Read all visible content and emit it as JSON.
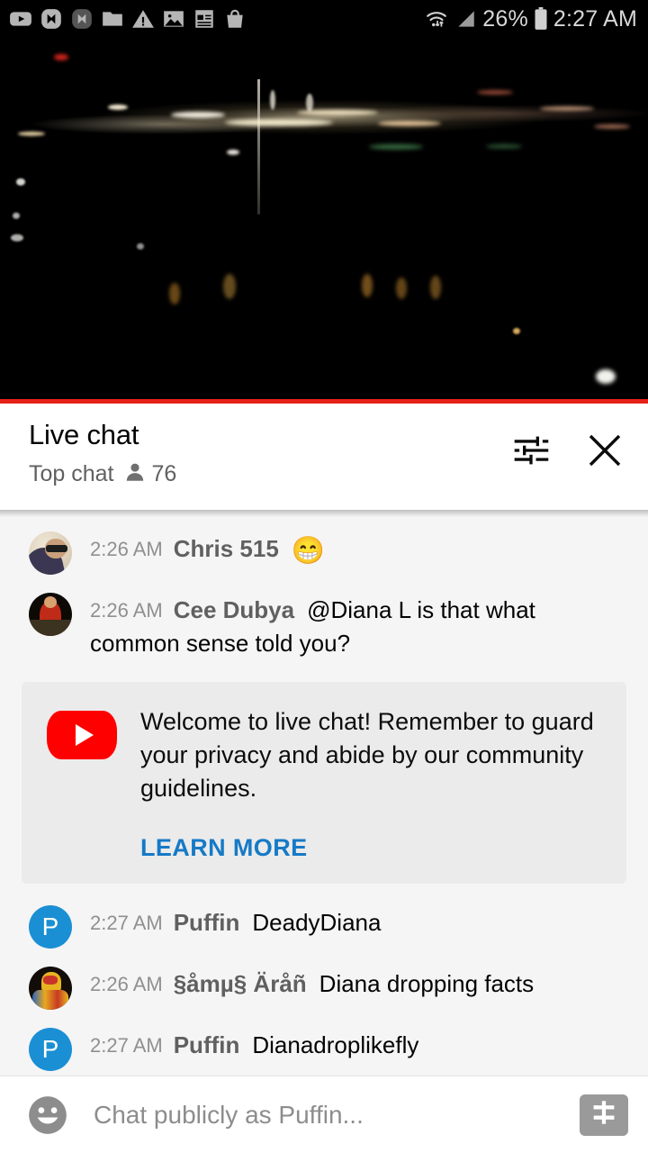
{
  "statusbar": {
    "icons": [
      "youtube-icon",
      "messenger-icon",
      "messenger-alt-icon",
      "folder-icon",
      "warning-icon",
      "image-icon",
      "news-icon",
      "bag-icon"
    ],
    "wifi_icon": "wifi-icon",
    "signal_icon": "cellular-signal-icon",
    "battery_percent": "26%",
    "battery_icon": "battery-icon",
    "time": "2:27 AM"
  },
  "video": {
    "description": "night-cityscape-live-stream",
    "progress_color": "#e62117"
  },
  "chat_header": {
    "title": "Live chat",
    "mode": "Top chat",
    "viewer_icon": "person-icon",
    "viewer_count": "76",
    "settings_icon": "tune-sliders-icon",
    "close_icon": "close-x-icon"
  },
  "messages": [
    {
      "avatar": "av-chris",
      "avatar_kind": "photo",
      "time": "2:26 AM",
      "author": "Chris 515",
      "text": "",
      "emoji": "😁"
    },
    {
      "avatar": "av-cee",
      "avatar_kind": "photo",
      "time": "2:26 AM",
      "author": "Cee Dubya",
      "text": "@Diana L is that what common sense told you?",
      "emoji": ""
    }
  ],
  "welcome_card": {
    "logo_icon": "youtube-play-icon",
    "text": "Welcome to live chat! Remember to guard your privacy and abide by our community guidelines.",
    "link_label": "LEARN MORE",
    "link_color": "#167ac6"
  },
  "messages_after": [
    {
      "avatar": "letter",
      "avatar_kind": "letter",
      "avatar_letter": "P",
      "avatar_color": "#1b8fd4",
      "time": "2:27 AM",
      "author": "Puffin",
      "text": "DeadyDiana",
      "emoji": ""
    },
    {
      "avatar": "av-samus",
      "avatar_kind": "photo",
      "time": "2:26 AM",
      "author": "§åmµ§ Äråñ",
      "text": "Diana dropping facts",
      "emoji": ""
    },
    {
      "avatar": "letter",
      "avatar_kind": "letter",
      "avatar_letter": "P",
      "avatar_color": "#1b8fd4",
      "time": "2:27 AM",
      "author": "Puffin",
      "text": "Dianadroplikefly",
      "emoji": ""
    }
  ],
  "input_bar": {
    "emoji_icon": "emoji-smiley-icon",
    "placeholder": "Chat publicly as Puffin...",
    "superchat_icon": "superchat-dollar-icon"
  }
}
